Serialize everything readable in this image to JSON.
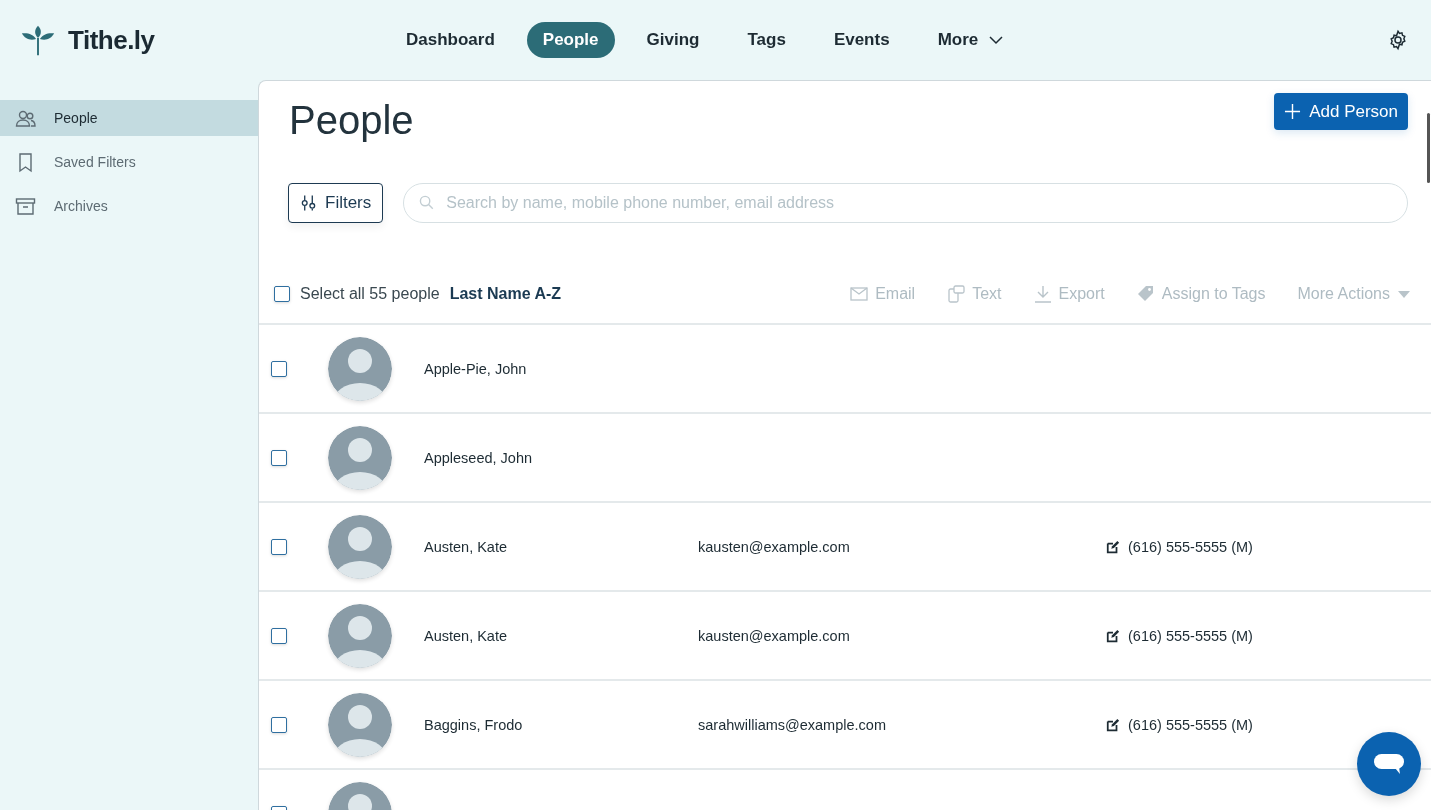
{
  "brand": {
    "name": "Tithe.ly"
  },
  "nav": [
    {
      "label": "Dashboard",
      "selected": false
    },
    {
      "label": "People",
      "selected": true
    },
    {
      "label": "Giving",
      "selected": false
    },
    {
      "label": "Tags",
      "selected": false
    },
    {
      "label": "Events",
      "selected": false
    },
    {
      "label": "More",
      "selected": false,
      "kind": "dropdown"
    }
  ],
  "sidebar": {
    "items": [
      {
        "label": "People",
        "kind": "people",
        "selected": true
      },
      {
        "label": "Saved Filters",
        "kind": "bookmark",
        "selected": false
      },
      {
        "label": "Archives",
        "kind": "archive",
        "selected": false
      }
    ]
  },
  "page": {
    "title": "People",
    "add_button": "Add Person",
    "filters_button": "Filters",
    "search": {
      "placeholder": "Search by name, mobile phone number, email address"
    }
  },
  "list_toolbar": {
    "select_all": {
      "label": "Select all 55 people",
      "checked": false
    },
    "sort": "Last Name A-Z",
    "actions": [
      {
        "label": "Email",
        "kind": "email",
        "disabled": true
      },
      {
        "label": "Text",
        "kind": "text",
        "disabled": true
      },
      {
        "label": "Export",
        "kind": "export",
        "disabled": true
      },
      {
        "label": "Assign to Tags",
        "kind": "tag",
        "disabled": true
      },
      {
        "label": "More Actions",
        "kind": "dropdown",
        "disabled": true
      }
    ]
  },
  "people": [
    {
      "name": "Apple-Pie, John",
      "checked": false
    },
    {
      "name": "Appleseed, John",
      "checked": false
    },
    {
      "name": "Austen, Kate",
      "email": "kausten@example.com",
      "phone": "(616) 555-5555 (M)",
      "checked": false
    },
    {
      "name": "Austen, Kate",
      "email": "kausten@example.com",
      "phone": "(616) 555-5555 (M)",
      "checked": false
    },
    {
      "name": "Baggins, Frodo",
      "email": "sarahwilliams@example.com",
      "phone": "(616) 555-5555 (M)",
      "checked": false
    },
    {
      "checked": false
    }
  ]
}
